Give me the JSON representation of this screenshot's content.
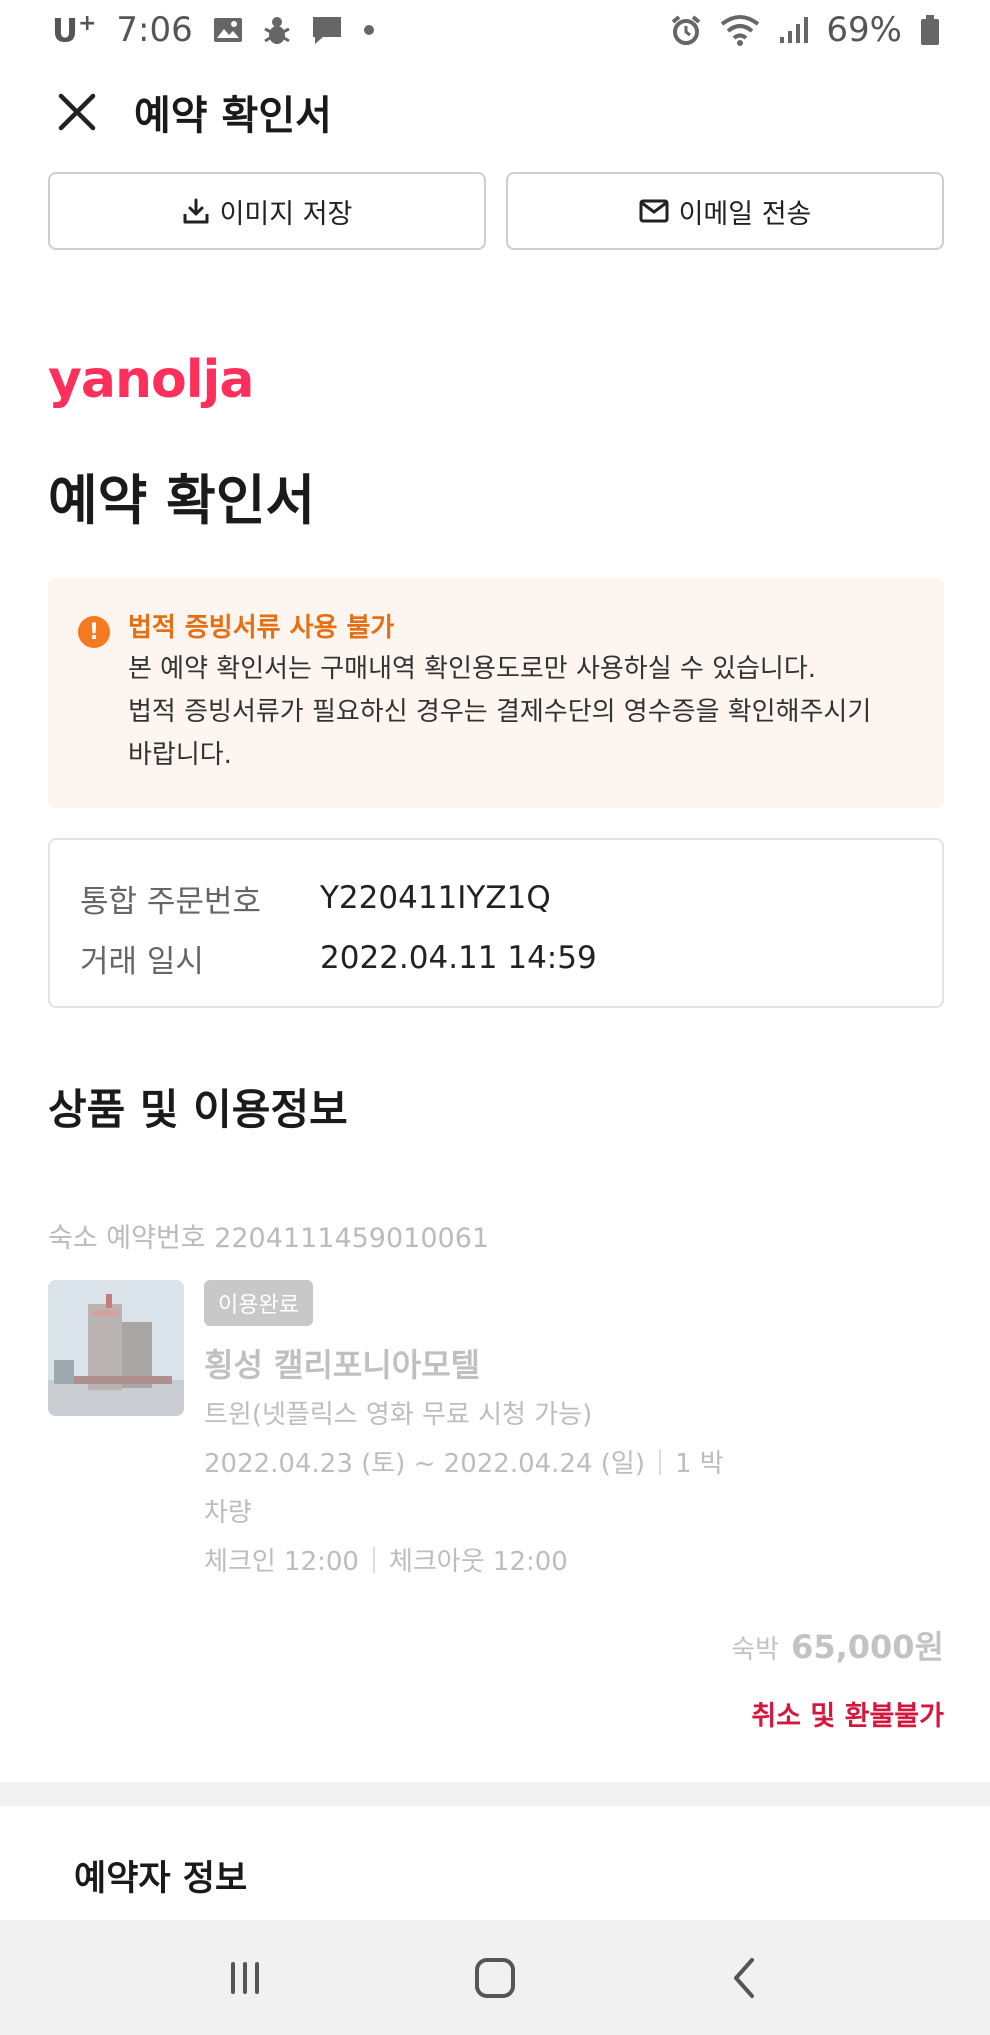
{
  "status_bar": {
    "carrier": "U",
    "carrier_sup": "+",
    "time": "7:06",
    "battery": "69%",
    "icons": [
      "image-icon",
      "bug-icon",
      "message-icon",
      "dot-icon",
      "alarm-icon",
      "wifi-icon",
      "signal-icon",
      "battery-icon"
    ]
  },
  "header": {
    "title": "예약 확인서",
    "close_icon": "close-icon"
  },
  "actions": {
    "save_image": "이미지 저장",
    "send_email": "이메일 전송"
  },
  "brand": {
    "logo": "yanolja",
    "color": "#ff2f5c"
  },
  "document_title": "예약 확인서",
  "notice": {
    "title": "법적 증빙서류 사용 불가",
    "lines": [
      "본 예약 확인서는 구매내역 확인용도로만 사용하실 수 있습니다.",
      "법적 증빙서류가 필요하신 경우는 결제수단의 영수증을 확인해주시기",
      "바랍니다."
    ],
    "accent": "#e56f12"
  },
  "order": {
    "rows": [
      {
        "label": "통합 주문번호",
        "value": "Y220411IYZ1Q"
      },
      {
        "label": "거래 일시",
        "value": "2022.04.11 14:59"
      }
    ]
  },
  "product_section": {
    "title": "상품 및 이용정보",
    "reservation_number": "숙소 예약번호 2204111459010061",
    "badge": "이용완료",
    "hotel_name": "횡성 캘리포니아모텔",
    "room_type": "트윈(넷플릭스 영화 무료 시청 가능)",
    "dates": "2022.04.23 (토) ~ 2022.04.24 (일)",
    "nights": "1 박",
    "vehicle": "차량",
    "check_in": "체크인 12:00",
    "check_out": "체크아웃 12:00",
    "price_label": "숙박",
    "price": "65,000원",
    "refund_policy": "취소 및 환불불가",
    "refund_color": "#d6173d"
  },
  "booker_section": {
    "title": "예약자 정보"
  },
  "navbar": {
    "icons": [
      "recent-apps-icon",
      "home-icon",
      "back-icon"
    ]
  }
}
